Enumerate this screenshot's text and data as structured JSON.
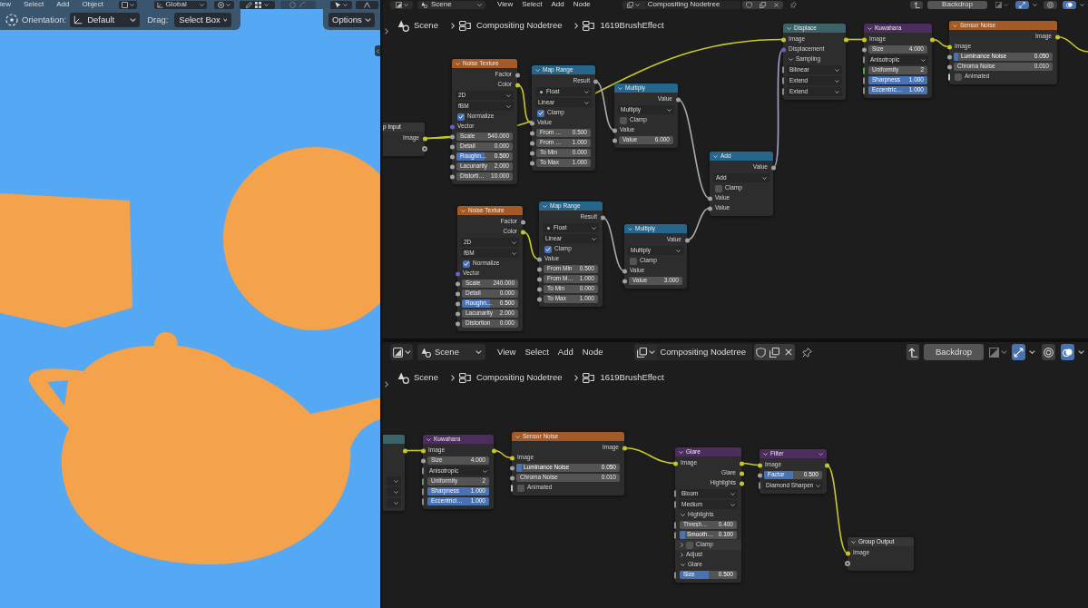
{
  "viewport": {
    "menu": [
      "iew",
      "Select",
      "Add",
      "Object"
    ],
    "transform_orientation": "Global",
    "tool_settings": {
      "orientation_label": "Orientation:",
      "orientation": "Default",
      "drag_label": "Drag:",
      "drag": "Select Box"
    },
    "options": "Options"
  },
  "node_editors": [
    {
      "header": {
        "scene": "Scene",
        "menu": [
          "View",
          "Select",
          "Add",
          "Node"
        ],
        "node_tree": "Compositing Nodetree",
        "backdrop": {
          "label": "Backdrop",
          "on": false
        },
        "toggles": [
          {
            "kind": "snap",
            "on": true
          },
          {
            "kind": "gizmo",
            "on": false
          },
          {
            "kind": "overlay",
            "on": true
          }
        ]
      },
      "breadcrumbs": [
        "Scene",
        "Compositing Nodetree",
        "1619BrushEffect"
      ],
      "nodes": [
        {
          "title": "p Input",
          "color": "#363636",
          "rows": [
            {
              "kind": "output",
              "label": "Image",
              "socket": {
                "kind": "dot",
                "color": "#c7c729"
              }
            },
            {
              "kind": "output",
              "socket": {
                "kind": "ring",
                "color": "#a1a1a1"
              }
            }
          ]
        },
        {
          "title": "Noise Texture",
          "color": "#a35a26",
          "rows": [
            {
              "kind": "output",
              "label": "Factor",
              "socket": {
                "kind": "dot",
                "color": "#a1a1a1"
              }
            },
            {
              "kind": "output",
              "label": "Color",
              "socket": {
                "kind": "dot",
                "color": "#c7c729"
              }
            },
            {
              "kind": "dropdown",
              "value": "2D"
            },
            {
              "kind": "dropdown",
              "value": "fBM"
            },
            {
              "kind": "checkbox",
              "label": "Normalize",
              "checked": true
            },
            {
              "kind": "input",
              "label": "Vector",
              "socket": {
                "kind": "dot",
                "color": "#6363c7"
              }
            },
            {
              "kind": "field",
              "label": "Scale",
              "value": "540.000",
              "socket": {
                "kind": "dot",
                "color": "#a1a1a1"
              }
            },
            {
              "kind": "field",
              "label": "Detail",
              "value": "0.000",
              "socket": {
                "kind": "dot",
                "color": "#a1a1a1"
              }
            },
            {
              "kind": "field",
              "label": "Roughn…",
              "value": "0.500",
              "socket": {
                "kind": "dot",
                "color": "#a1a1a1"
              },
              "level": 0.5
            },
            {
              "kind": "field",
              "label": "Lacunarity",
              "value": "2.000",
              "socket": {
                "kind": "dot",
                "color": "#a1a1a1"
              }
            },
            {
              "kind": "field",
              "label": "Distorti…",
              "value": "10.000",
              "socket": {
                "kind": "dot",
                "color": "#a1a1a1"
              }
            }
          ]
        },
        {
          "title": "Map Range",
          "color": "#27668c",
          "rows": [
            {
              "kind": "output",
              "label": "Result",
              "socket": {
                "kind": "dot",
                "color": "#a1a1a1"
              }
            },
            {
              "kind": "type_dropdown",
              "value": "Float"
            },
            {
              "kind": "dropdown",
              "value": "Linear"
            },
            {
              "kind": "checkbox",
              "label": "Clamp",
              "checked": true
            },
            {
              "kind": "input",
              "label": "Value",
              "socket": {
                "kind": "dot",
                "color": "#a1a1a1"
              }
            },
            {
              "kind": "field",
              "label": "From …",
              "value": "0.500",
              "socket": {
                "kind": "dot",
                "color": "#a1a1a1"
              }
            },
            {
              "kind": "field",
              "label": "From …",
              "value": "1.000",
              "socket": {
                "kind": "dot",
                "color": "#a1a1a1"
              }
            },
            {
              "kind": "field",
              "label": "To Min",
              "value": "0.000",
              "socket": {
                "kind": "dot",
                "color": "#a1a1a1"
              }
            },
            {
              "kind": "field",
              "label": "To Max",
              "value": "1.000",
              "socket": {
                "kind": "dot",
                "color": "#a1a1a1"
              }
            }
          ]
        },
        {
          "title": "Multiply",
          "color": "#27668c",
          "rows": [
            {
              "kind": "output",
              "label": "Value",
              "socket": {
                "kind": "dot",
                "color": "#a1a1a1"
              }
            },
            {
              "kind": "dropdown",
              "value": "Multiply"
            },
            {
              "kind": "checkbox",
              "label": "Clamp",
              "checked": false
            },
            {
              "kind": "input",
              "label": "Value",
              "socket": {
                "kind": "dot",
                "color": "#a1a1a1"
              }
            },
            {
              "kind": "field",
              "label": "Value",
              "value": "6.000",
              "socket": {
                "kind": "dot",
                "color": "#a1a1a1"
              }
            }
          ]
        },
        {
          "title": "Add",
          "color": "#27668c",
          "rows": [
            {
              "kind": "output",
              "label": "Value",
              "socket": {
                "kind": "dot",
                "color": "#a1a1a1"
              }
            },
            {
              "kind": "dropdown",
              "value": "Add"
            },
            {
              "kind": "checkbox",
              "label": "Clamp",
              "checked": false
            },
            {
              "kind": "input",
              "label": "Value",
              "socket": {
                "kind": "dot",
                "color": "#a1a1a1"
              }
            },
            {
              "kind": "input",
              "label": "Value",
              "socket": {
                "kind": "dot",
                "color": "#a1a1a1"
              }
            }
          ]
        },
        {
          "title": "Displace",
          "color": "#3b6468",
          "rows": [
            {
              "kind": "input",
              "label": "Image",
              "socket": {
                "kind": "dot",
                "color": "#c7c729"
              },
              "out_socket": {
                "kind": "dot",
                "color": "#c7c729"
              }
            },
            {
              "kind": "input",
              "label": "Displacement",
              "socket": {
                "kind": "dot",
                "color": "#6363c7"
              }
            },
            {
              "kind": "panel",
              "label": "Sampling",
              "expanded": true
            },
            {
              "kind": "dropdown",
              "value": "Bilinear",
              "socket": {
                "kind": "bar",
                "color": "#8c8c8c"
              }
            },
            {
              "kind": "dropdown",
              "value": "Extend",
              "socket": {
                "kind": "bar",
                "color": "#8c8c8c"
              }
            },
            {
              "kind": "dropdown",
              "value": "Extend",
              "socket": {
                "kind": "bar",
                "color": "#8c8c8c"
              }
            }
          ]
        },
        {
          "title": "Kuwahara",
          "color": "#4c2e5e",
          "rows": [
            {
              "kind": "input",
              "label": "Image",
              "socket": {
                "kind": "dot",
                "color": "#c7c729"
              },
              "out_socket": {
                "kind": "dot",
                "color": "#c7c729"
              }
            },
            {
              "kind": "field",
              "label": "Size",
              "value": "4.000",
              "socket": {
                "kind": "dot",
                "color": "#a1a1a1"
              }
            },
            {
              "kind": "dropdown",
              "value": "Anisotropic",
              "socket": {
                "kind": "bar",
                "color": "#8c8c8c"
              }
            },
            {
              "kind": "field",
              "label": "Uniformity",
              "value": "2",
              "socket": {
                "kind": "bar",
                "color": "#5c9c5c"
              }
            },
            {
              "kind": "field",
              "label": "Sharpness",
              "value": "1.000",
              "socket": {
                "kind": "bar",
                "color": "#8c8c8c"
              },
              "level": 1
            },
            {
              "kind": "field",
              "label": "Eccentric…",
              "value": "1.000",
              "socket": {
                "kind": "bar",
                "color": "#8c8c8c"
              },
              "level": 1
            }
          ]
        },
        {
          "title": "Sensor Noise",
          "color": "#a35a26",
          "rows": [
            {
              "kind": "output",
              "label": "Image",
              "socket": {
                "kind": "dot",
                "color": "#c7c729"
              }
            },
            {
              "kind": "input",
              "label": "Image",
              "socket": {
                "kind": "dot",
                "color": "#c7c729"
              }
            },
            {
              "kind": "field",
              "label": "Luminance Noise",
              "value": "0.050",
              "socket": {
                "kind": "dot",
                "color": "#a1a1a1"
              },
              "level": 0.05
            },
            {
              "kind": "field",
              "label": "Chroma Noise",
              "value": "0.010",
              "socket": {
                "kind": "dot",
                "color": "#a1a1a1"
              }
            },
            {
              "kind": "checkbox",
              "label": "Animated",
              "checked": false,
              "socket": {
                "kind": "bar",
                "color": "#d6b8dc"
              }
            }
          ]
        },
        {
          "title": "Noise Texture",
          "color": "#a35a26",
          "rows": [
            {
              "kind": "output",
              "label": "Factor",
              "socket": {
                "kind": "dot",
                "color": "#a1a1a1"
              }
            },
            {
              "kind": "output",
              "label": "Color",
              "socket": {
                "kind": "dot",
                "color": "#c7c729"
              }
            },
            {
              "kind": "dropdown",
              "value": "2D"
            },
            {
              "kind": "dropdown",
              "value": "fBM"
            },
            {
              "kind": "checkbox",
              "label": "Normalize",
              "checked": true
            },
            {
              "kind": "input",
              "label": "Vector",
              "socket": {
                "kind": "dot",
                "color": "#6363c7"
              }
            },
            {
              "kind": "field",
              "label": "Scale",
              "value": "240.000",
              "socket": {
                "kind": "dot",
                "color": "#a1a1a1"
              }
            },
            {
              "kind": "field",
              "label": "Detail",
              "value": "0.000",
              "socket": {
                "kind": "dot",
                "color": "#a1a1a1"
              }
            },
            {
              "kind": "field",
              "label": "Roughn…",
              "value": "0.500",
              "socket": {
                "kind": "dot",
                "color": "#a1a1a1"
              },
              "level": 0.5
            },
            {
              "kind": "field",
              "label": "Lacunarity",
              "value": "2.000",
              "socket": {
                "kind": "dot",
                "color": "#a1a1a1"
              }
            },
            {
              "kind": "field",
              "label": "Distortion",
              "value": "0.000",
              "socket": {
                "kind": "dot",
                "color": "#a1a1a1"
              }
            }
          ]
        },
        {
          "title": "Map Range",
          "color": "#27668c",
          "rows": [
            {
              "kind": "output",
              "label": "Result",
              "socket": {
                "kind": "dot",
                "color": "#a1a1a1"
              }
            },
            {
              "kind": "type_dropdown",
              "value": "Float"
            },
            {
              "kind": "dropdown",
              "value": "Linear"
            },
            {
              "kind": "checkbox",
              "label": "Clamp",
              "checked": true
            },
            {
              "kind": "input",
              "label": "Value",
              "socket": {
                "kind": "dot",
                "color": "#a1a1a1"
              }
            },
            {
              "kind": "field",
              "label": "From Min",
              "value": "0.500",
              "socket": {
                "kind": "dot",
                "color": "#a1a1a1"
              }
            },
            {
              "kind": "field",
              "label": "From M…",
              "value": "1.000",
              "socket": {
                "kind": "dot",
                "color": "#a1a1a1"
              }
            },
            {
              "kind": "field",
              "label": "To Min",
              "value": "0.000",
              "socket": {
                "kind": "dot",
                "color": "#a1a1a1"
              }
            },
            {
              "kind": "field",
              "label": "To Max",
              "value": "1.000",
              "socket": {
                "kind": "dot",
                "color": "#a1a1a1"
              }
            }
          ]
        },
        {
          "title": "Multiply",
          "color": "#27668c",
          "rows": [
            {
              "kind": "output",
              "label": "Value",
              "socket": {
                "kind": "dot",
                "color": "#a1a1a1"
              }
            },
            {
              "kind": "dropdown",
              "value": "Multiply"
            },
            {
              "kind": "checkbox",
              "label": "Clamp",
              "checked": false
            },
            {
              "kind": "input",
              "label": "Value",
              "socket": {
                "kind": "dot",
                "color": "#a1a1a1"
              }
            },
            {
              "kind": "field",
              "label": "Value",
              "value": "3.000",
              "socket": {
                "kind": "dot",
                "color": "#a1a1a1"
              }
            }
          ]
        }
      ]
    },
    {
      "header": {
        "scene": "Scene",
        "menu": [
          "View",
          "Select",
          "Add",
          "Node"
        ],
        "node_tree": "Compositing Nodetree",
        "backdrop": {
          "label": "Backdrop",
          "on": false
        },
        "toggles": [
          {
            "kind": "snap",
            "on": true
          },
          {
            "kind": "gizmo",
            "on": false
          },
          {
            "kind": "overlay",
            "on": true
          }
        ]
      },
      "breadcrumbs": [
        "Scene",
        "Compositing Nodetree",
        "1619BrushEffect"
      ],
      "nodes": [
        {
          "color": "#3b6468",
          "rows": [
            {
              "kind": "input",
              "out_socket": {
                "kind": "dot",
                "color": "#c7c729"
              }
            },
            {
              "kind": "input"
            },
            {
              "kind": "input"
            },
            {
              "kind": "dropdown"
            },
            {
              "kind": "dropdown"
            },
            {
              "kind": "dropdown"
            }
          ]
        },
        {
          "title": "Kuwahara",
          "color": "#4c2e5e",
          "rows": [
            {
              "kind": "input",
              "label": "Image",
              "socket": {
                "kind": "dot",
                "color": "#c7c729"
              },
              "out_socket": {
                "kind": "dot",
                "color": "#c7c729"
              }
            },
            {
              "kind": "field",
              "label": "Size",
              "value": "4.000",
              "socket": {
                "kind": "dot",
                "color": "#a1a1a1"
              }
            },
            {
              "kind": "dropdown",
              "value": "Anisotropic",
              "socket": {
                "kind": "bar",
                "color": "#8c8c8c"
              }
            },
            {
              "kind": "field",
              "label": "Uniformity",
              "value": "2",
              "socket": {
                "kind": "bar",
                "color": "#5c9c5c"
              }
            },
            {
              "kind": "field",
              "label": "Sharpness",
              "value": "1.000",
              "socket": {
                "kind": "bar",
                "color": "#8c8c8c"
              },
              "level": 1
            },
            {
              "kind": "field",
              "label": "Eccentrici…",
              "value": "1.000",
              "socket": {
                "kind": "bar",
                "color": "#8c8c8c"
              },
              "level": 1
            }
          ]
        },
        {
          "title": "Sensor Noise",
          "color": "#a35a26",
          "rows": [
            {
              "kind": "output",
              "label": "Image",
              "socket": {
                "kind": "dot",
                "color": "#c7c729"
              }
            },
            {
              "kind": "input",
              "label": "Image",
              "socket": {
                "kind": "dot",
                "color": "#c7c729"
              }
            },
            {
              "kind": "field",
              "label": "Luminance Noise",
              "value": "0.050",
              "socket": {
                "kind": "dot",
                "color": "#a1a1a1"
              },
              "level": 0.05
            },
            {
              "kind": "field",
              "label": "Chroma Noise",
              "value": "0.010",
              "socket": {
                "kind": "dot",
                "color": "#a1a1a1"
              }
            },
            {
              "kind": "checkbox",
              "label": "Animated",
              "checked": false,
              "socket": {
                "kind": "bar",
                "color": "#d6b8dc"
              }
            }
          ]
        },
        {
          "title": "Glare",
          "color": "#4c2e5e",
          "rows": [
            {
              "kind": "input",
              "label": "Image",
              "socket": {
                "kind": "dot",
                "color": "#c7c729"
              },
              "out_socket": {
                "kind": "dot",
                "color": "#c7c729"
              }
            },
            {
              "kind": "output",
              "label": "Glare",
              "socket": {
                "kind": "dot",
                "color": "#c7c729"
              }
            },
            {
              "kind": "output",
              "label": "Highlights",
              "socket": {
                "kind": "dot",
                "color": "#c7c729"
              }
            },
            {
              "kind": "dropdown",
              "value": "Bloom",
              "socket": {
                "kind": "bar",
                "color": "#8c8c8c"
              }
            },
            {
              "kind": "dropdown",
              "value": "Medium",
              "socket": {
                "kind": "bar",
                "color": "#8c8c8c"
              }
            },
            {
              "kind": "panel",
              "label": "Highlights",
              "expanded": true
            },
            {
              "kind": "field",
              "label": "Thresh…",
              "value": "0.400",
              "socket": {
                "kind": "bar",
                "color": "#8c8c8c"
              }
            },
            {
              "kind": "field",
              "label": "Smooth…",
              "value": "0.100",
              "socket": {
                "kind": "bar",
                "color": "#8c8c8c"
              },
              "level": 0.1
            },
            {
              "kind": "panel",
              "label": "Clamp",
              "expanded": false,
              "checked": false
            },
            {
              "kind": "panel",
              "label": "Adjust",
              "expanded": false
            },
            {
              "kind": "panel",
              "label": "Glare",
              "expanded": true
            },
            {
              "kind": "field",
              "label": "Size",
              "value": "0.500",
              "socket": {
                "kind": "bar",
                "color": "#8c8c8c"
              },
              "level": 0.5
            }
          ]
        },
        {
          "title": "Filter",
          "color": "#4c2e5e",
          "header_caret": true,
          "rows": [
            {
              "kind": "input",
              "label": "Image",
              "socket": {
                "kind": "dot",
                "color": "#c7c729"
              },
              "out_socket": {
                "kind": "dot",
                "color": "#c7c729"
              }
            },
            {
              "kind": "field",
              "label": "Factor",
              "value": "0.500",
              "socket": {
                "kind": "dot",
                "color": "#a1a1a1"
              },
              "level": 0.5
            },
            {
              "kind": "dropdown",
              "value": "Diamond Sharpen",
              "socket": {
                "kind": "bar",
                "color": "#8c8c8c"
              }
            }
          ]
        },
        {
          "title": "Group Output",
          "color": "#363636",
          "rows": [
            {
              "kind": "input",
              "label": "Image",
              "socket": {
                "kind": "dot",
                "color": "#c7c729"
              }
            },
            {
              "kind": "input",
              "socket": {
                "kind": "ring",
                "color": "#a1a1a1"
              }
            }
          ]
        }
      ]
    }
  ]
}
